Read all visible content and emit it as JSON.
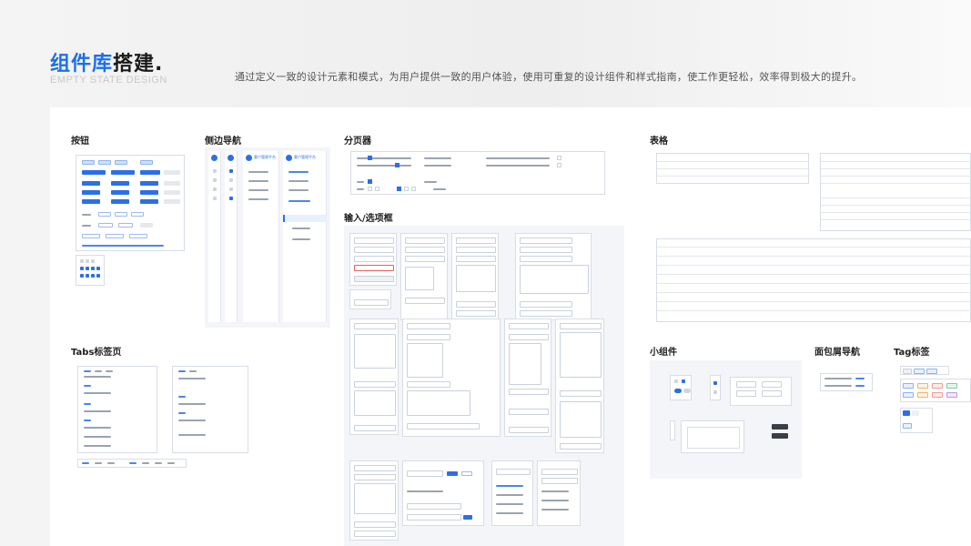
{
  "header": {
    "title_blue": "组件库",
    "title_dark": "搭建.",
    "subtitle": "EMPTY STATE DESIGN",
    "description": "通过定义一致的设计元素和模式，为用户提供一致的用户体验，使用可重复的设计组件和样式指南，使工作更轻松，效率得到极大的提升。"
  },
  "sections": {
    "buttons": "按钮",
    "side_nav": "侧边导航",
    "pagination": "分页器",
    "table": "表格",
    "input_select": "输入/选项框",
    "tabs": "Tabs标签页",
    "widgets": "小组件",
    "breadcrumb": "面包屑导航",
    "tags": "Tag标签"
  },
  "side_nav": {
    "platform_name": "客户管理平台"
  },
  "colors": {
    "accent": "#1d6fe8",
    "board": "#ffffff",
    "panel": "#f3f5f8"
  }
}
